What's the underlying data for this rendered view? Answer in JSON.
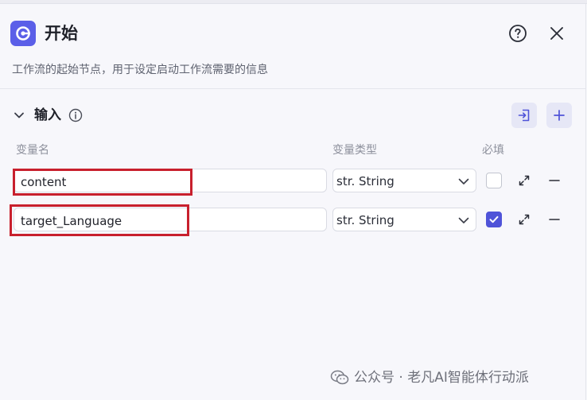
{
  "header": {
    "title": "开始",
    "description": "工作流的起始节点，用于设定启动工作流需要的信息"
  },
  "section": {
    "title": "输入"
  },
  "columns": {
    "name": "变量名",
    "type": "变量类型",
    "required": "必填"
  },
  "variables": [
    {
      "name": "content",
      "type_prefix": "str.",
      "type_label": "String",
      "required": false
    },
    {
      "name": "target_Language",
      "type_prefix": "str.",
      "type_label": "String",
      "required": true
    }
  ],
  "type_display": [
    "str. String",
    "str. String"
  ],
  "watermark": {
    "text": "公众号 · 老凡AI智能体行动派"
  },
  "colors": {
    "accent": "#5b5fe8",
    "checkbox_checked": "#4f53d8",
    "highlight_box": "#c8202d",
    "panel_bg": "#f7f7fb"
  },
  "icons": {
    "node": "start-node-icon",
    "help": "question-circle-icon",
    "close": "close-icon",
    "collapse": "chevron-down-icon",
    "info": "info-icon",
    "import": "import-icon",
    "add": "plus-icon",
    "expand": "expand-icon",
    "remove": "minus-icon",
    "watermark": "wechat-icon"
  }
}
